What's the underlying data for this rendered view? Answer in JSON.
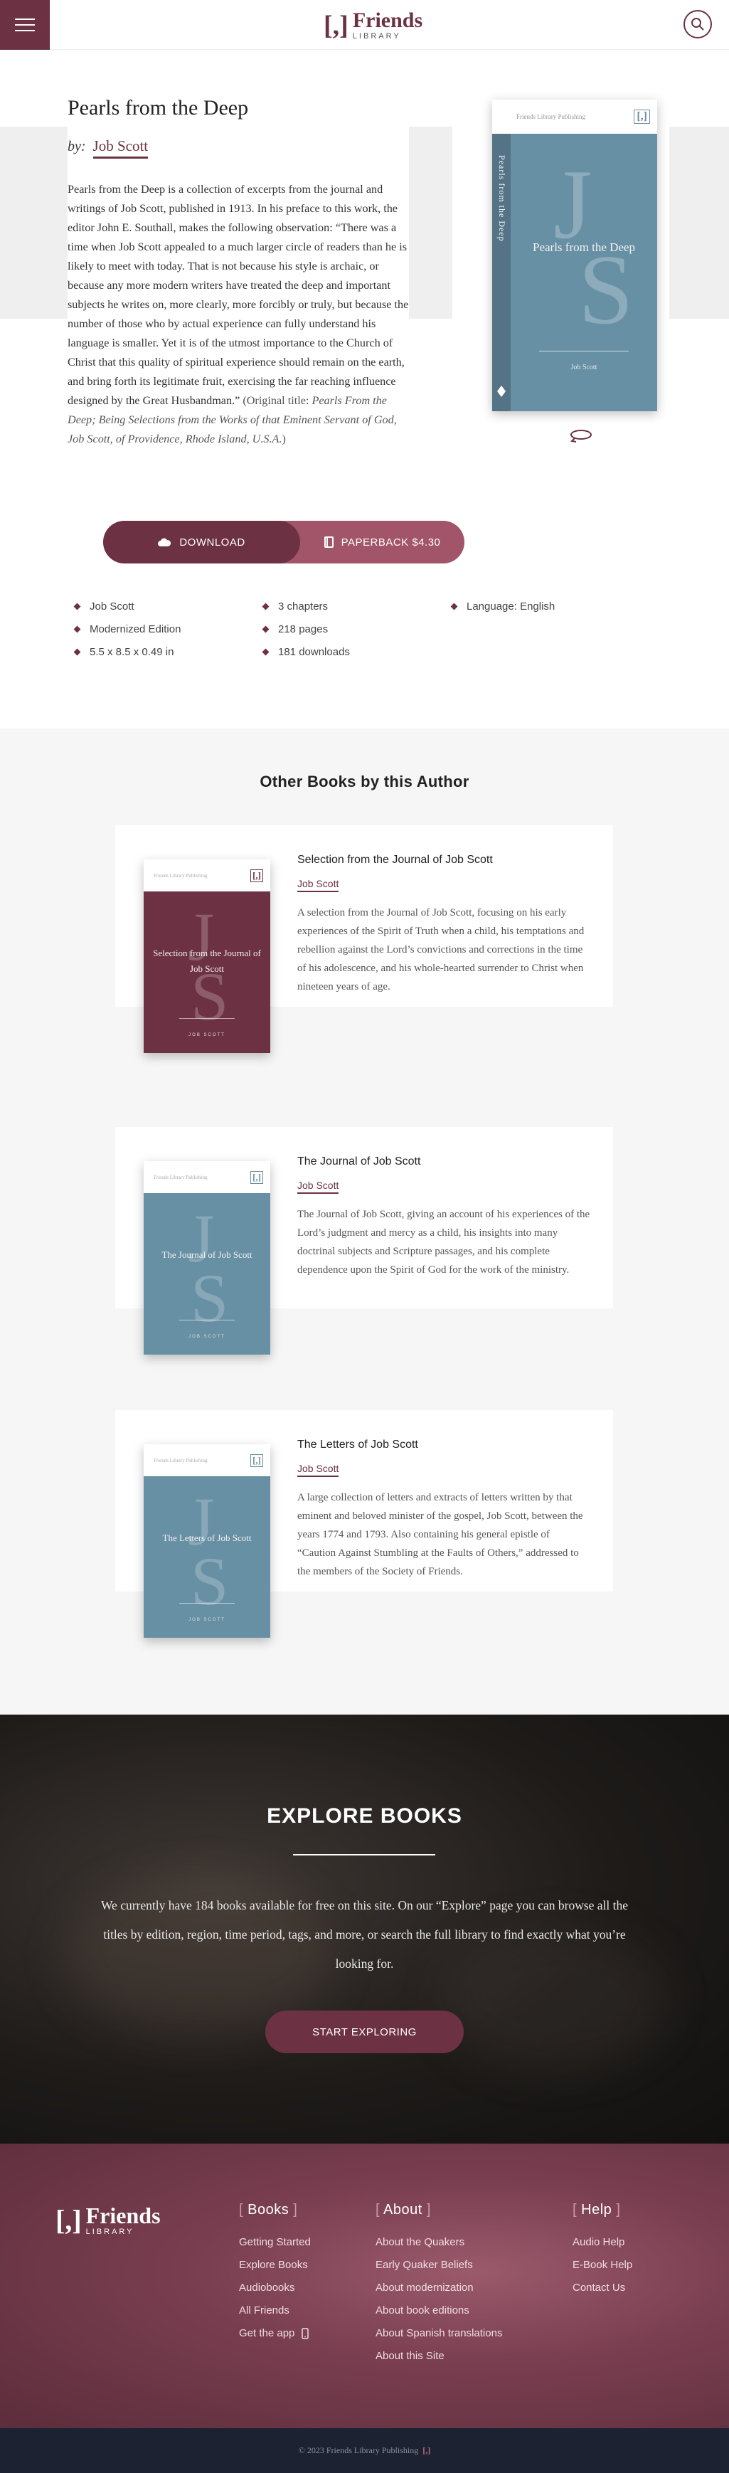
{
  "header": {
    "logo_bracket": "[,]",
    "logo_word": "Friends",
    "logo_sub": "LIBRARY"
  },
  "book": {
    "title": "Pearls from the Deep",
    "by_label": "by:",
    "author": "Job Scott",
    "description": "Pearls from the Deep is a collection of excerpts from the journal and writings of Job Scott, published in 1913. In his preface to this work, the editor John E. Southall, makes the following observation: “There was a time when Job Scott appealed to a much larger circle of readers than he is likely to meet with today. That is not because his style is archaic, or because any more modern writers have treated the deep and important subjects he writes on, more clearly, more forcibly or truly, but because the number of those who by actual experience can fully understand his language is smaller. Yet it is of the utmost importance to the Church of Christ that this quality of spiritual experience should remain on the earth, and bring forth its legitimate fruit, exercising the far reaching influence designed by the Great Husbandman.”",
    "original_prefix": "(Original title: ",
    "original_title": "Pearls From the Deep; Being Selections from the Works of that Eminent Servant of God, Job Scott, of Providence, Rhode Island, U.S.A.",
    "original_suffix": ")",
    "cover": {
      "publisher": "Friends Library Publishing",
      "bracket": "[,]",
      "title": "Pearls from the Deep",
      "author": "Job Scott",
      "spine_text": "Pearls from the Deep",
      "letter_j": "J",
      "letter_s": "S",
      "color": "#6790a4"
    },
    "download_label": "DOWNLOAD",
    "paperback_label": "PAPERBACK $4.30",
    "meta": [
      "Job Scott",
      "3 chapters",
      "Language: English",
      "Modernized Edition",
      "218 pages",
      "",
      "5.5 x 8.5 x 0.49 in",
      "181 downloads"
    ]
  },
  "others": {
    "heading": "Other Books by this Author",
    "books": [
      {
        "title": "Selection from the Journal of Job Scott",
        "author": "Job Scott",
        "cover_title": "Selection from the Journal of Job Scott",
        "cover_color": "#6c3142",
        "bracket_color": "#6c3142",
        "description": "A selection from the Journal of Job Scott, focusing on his early experiences of the Spirit of Truth when a child, his temptations and rebellion against the Lord’s convictions and corrections in the time of his adolescence, and his whole-hearted surrender to Christ when nineteen years of age."
      },
      {
        "title": "The Journal of Job Scott",
        "author": "Job Scott",
        "cover_title": "The Journal of Job Scott",
        "cover_color": "#6790a4",
        "bracket_color": "#6790a4",
        "description": "The Journal of Job Scott, giving an account of his experiences of the Lord’s judgment and mercy as a child, his insights into many doctrinal subjects and Scripture passages, and his complete dependence upon the Spirit of God for the work of the ministry."
      },
      {
        "title": "The Letters of Job Scott",
        "author": "Job Scott",
        "cover_title": "The Letters of Job Scott",
        "cover_color": "#6790a4",
        "bracket_color": "#6790a4",
        "description": "A large collection of letters and extracts of letters written by that eminent and beloved minister of the gospel, Job Scott, between the years 1774 and 1793. Also containing his general epistle of “Caution Against Stumbling at the Faults of Others,” addressed to the members of the Society of Friends."
      }
    ],
    "mini_publisher": "Friends Library Publishing",
    "mini_bracket": "[,]",
    "mini_author": "JOB SCOTT"
  },
  "explore": {
    "title": "EXPLORE BOOKS",
    "text": "We currently have 184 books available for free on this site. On our “Explore” page you can browse all the titles by edition, region, time period, tags, and more, or search the full library to find exactly what you’re looking for.",
    "button": "START EXPLORING"
  },
  "footer": {
    "logo_bracket": "[,]",
    "logo_word": "Friends",
    "logo_sub": "LIBRARY",
    "columns": [
      {
        "heading": "Books",
        "links": [
          "Getting Started",
          "Explore Books",
          "Audiobooks",
          "All Friends",
          "Get the app"
        ]
      },
      {
        "heading": "About",
        "links": [
          "About the Quakers",
          "Early Quaker Beliefs",
          "About modernization",
          "About book editions",
          "About Spanish translations",
          "About this Site"
        ]
      },
      {
        "heading": "Help",
        "links": [
          "Audio Help",
          "E-Book Help",
          "Contact Us"
        ]
      }
    ],
    "copyright": "© 2023 Friends Library Publishing",
    "copyright_bracket": "[,]"
  },
  "colors": {
    "brand": "#6c3142",
    "brand_light": "#a25468",
    "footer_bottom": "#1d2233"
  }
}
